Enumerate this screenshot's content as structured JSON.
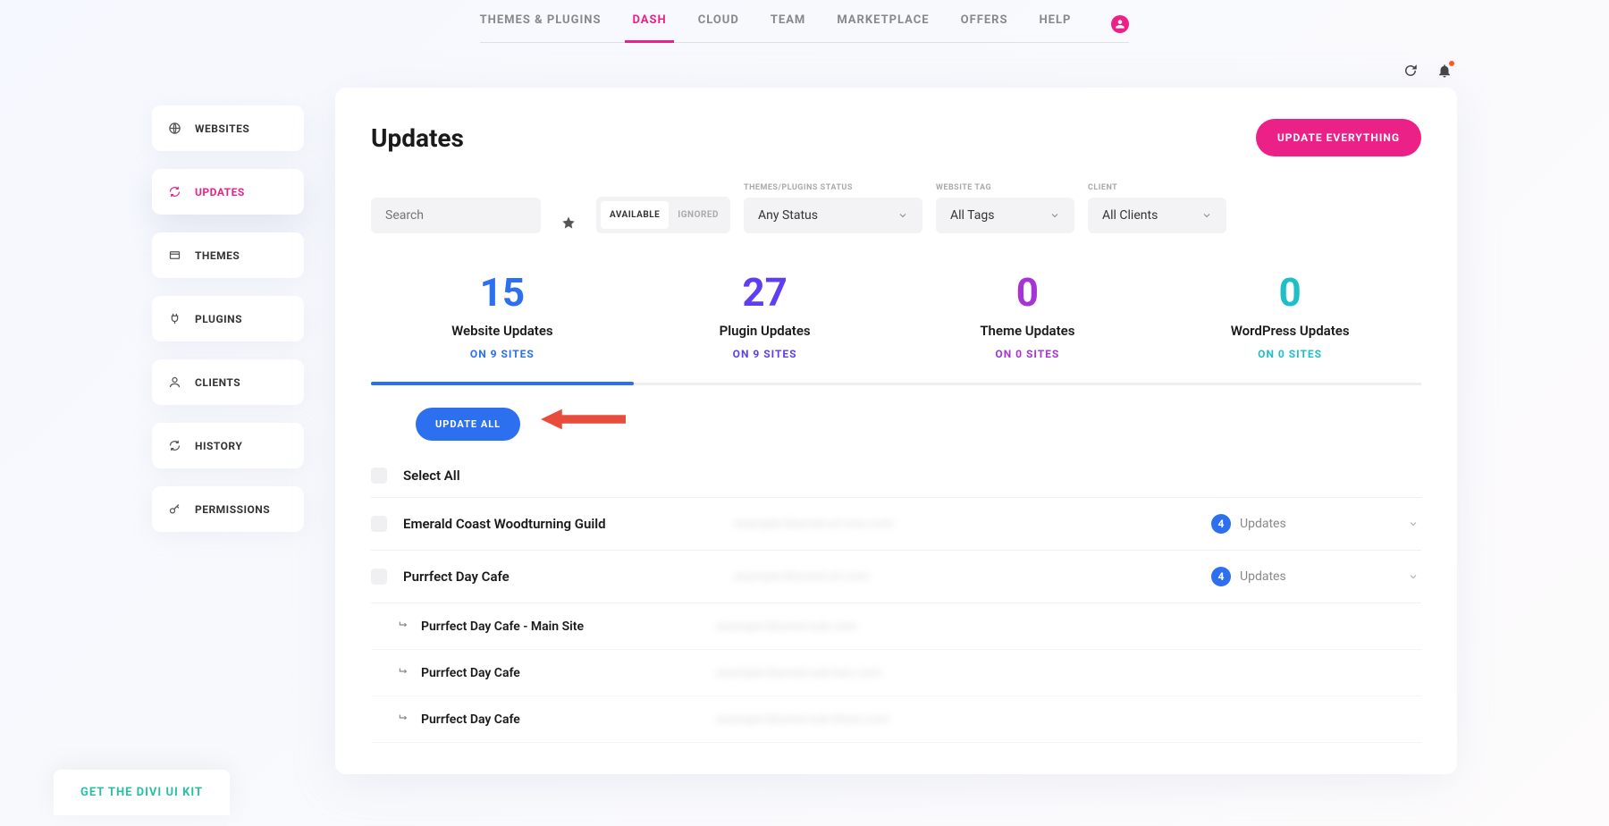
{
  "nav": {
    "items": [
      {
        "label": "THEMES & PLUGINS"
      },
      {
        "label": "DASH"
      },
      {
        "label": "CLOUD"
      },
      {
        "label": "TEAM"
      },
      {
        "label": "MARKETPLACE"
      },
      {
        "label": "OFFERS"
      },
      {
        "label": "HELP"
      }
    ],
    "active_index": 1
  },
  "sidebar": {
    "items": [
      {
        "label": "WEBSITES",
        "icon": "globe"
      },
      {
        "label": "UPDATES",
        "icon": "refresh"
      },
      {
        "label": "THEMES",
        "icon": "card"
      },
      {
        "label": "PLUGINS",
        "icon": "plug"
      },
      {
        "label": "CLIENTS",
        "icon": "user"
      },
      {
        "label": "HISTORY",
        "icon": "refresh"
      },
      {
        "label": "PERMISSIONS",
        "icon": "key"
      }
    ],
    "active_index": 1
  },
  "page": {
    "title": "Updates",
    "update_everything": "UPDATE EVERYTHING",
    "update_all": "UPDATE ALL",
    "select_all": "Select All"
  },
  "filters": {
    "search_placeholder": "Search",
    "toggle": {
      "available": "AVAILABLE",
      "ignored": "IGNORED",
      "active": "available"
    },
    "status": {
      "label": "THEMES/PLUGINS STATUS",
      "value": "Any Status"
    },
    "tag": {
      "label": "WEBSITE TAG",
      "value": "All Tags"
    },
    "client": {
      "label": "CLIENT",
      "value": "All Clients"
    }
  },
  "stats": [
    {
      "num": "15",
      "label": "Website Updates",
      "sites": "ON 9 SITES"
    },
    {
      "num": "27",
      "label": "Plugin Updates",
      "sites": "ON 9 SITES"
    },
    {
      "num": "0",
      "label": "Theme Updates",
      "sites": "ON 0 SITES"
    },
    {
      "num": "0",
      "label": "WordPress Updates",
      "sites": "ON 0 SITES"
    }
  ],
  "sites": [
    {
      "name": "Emerald Coast Woodturning Guild",
      "url": "example-blurred-url-one.com",
      "badge": "4",
      "badge_text": "Updates",
      "expandable": true
    },
    {
      "name": "Purrfect Day Cafe",
      "url": "example-blurred-url.com",
      "badge": "4",
      "badge_text": "Updates",
      "expandable": true,
      "subs": [
        {
          "name": "Purrfect Day Cafe - Main Site",
          "url": "example-blurred-sub.com"
        },
        {
          "name": "Purrfect Day Cafe",
          "url": "example-blurred-sub-two.com"
        },
        {
          "name": "Purrfect Day Cafe",
          "url": "example-blurred-sub-three.com"
        }
      ]
    }
  ],
  "footer": {
    "promo": "GET THE DIVI UI KIT"
  }
}
